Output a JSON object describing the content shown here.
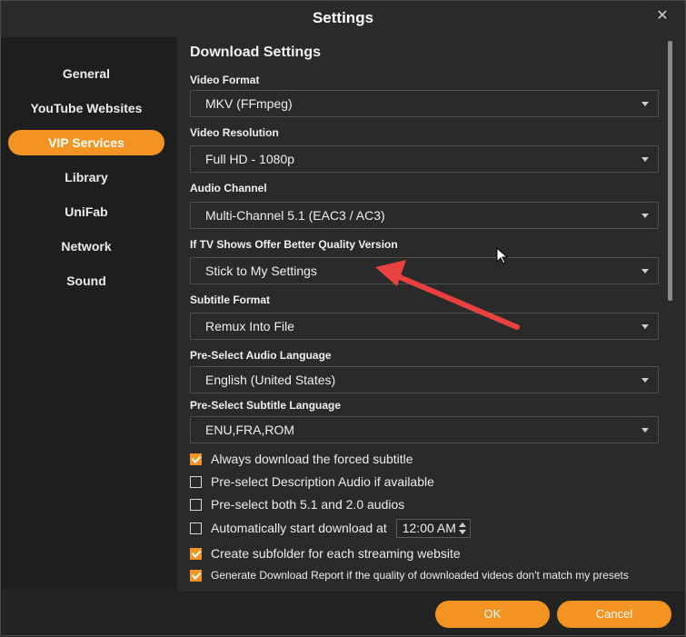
{
  "window": {
    "title": "Settings"
  },
  "sidebar": {
    "items": [
      {
        "label": "General"
      },
      {
        "label": "YouTube Websites"
      },
      {
        "label": "VIP Services"
      },
      {
        "label": "Library"
      },
      {
        "label": "UniFab"
      },
      {
        "label": "Network"
      },
      {
        "label": "Sound"
      }
    ],
    "active": "VIP Services"
  },
  "main": {
    "section_title": "Download Settings",
    "fields": [
      {
        "label": "Video Format",
        "value": "MKV (FFmpeg)"
      },
      {
        "label": "Video Resolution",
        "value": "Full HD - 1080p"
      },
      {
        "label": "Audio Channel",
        "value": "Multi-Channel 5.1 (EAC3 / AC3)"
      },
      {
        "label": "If TV Shows Offer Better Quality Version",
        "value": "Stick to My Settings"
      },
      {
        "label": "Subtitle Format",
        "value": "Remux Into File"
      },
      {
        "label": "Pre-Select Audio Language",
        "value": "English (United States)"
      },
      {
        "label": "Pre-Select Subtitle Language",
        "value": "ENU,FRA,ROM"
      }
    ],
    "checkboxes": [
      {
        "label": "Always download the forced subtitle",
        "checked": true
      },
      {
        "label": "Pre-select Description Audio if available",
        "checked": false
      },
      {
        "label": "Pre-select both 5.1 and 2.0 audios",
        "checked": false
      },
      {
        "label": "Automatically start download at",
        "checked": false,
        "time": "12:00 AM"
      },
      {
        "label": "Create subfolder for each streaming website",
        "checked": true
      },
      {
        "label": "Generate Download Report if the quality of downloaded videos don't match my presets",
        "checked": true
      }
    ]
  },
  "footer": {
    "ok_label": "OK",
    "cancel_label": "Cancel"
  },
  "colors": {
    "accent": "#f39322",
    "background": "#2a2a2a",
    "sidebar": "#1e1e1e",
    "annotation_arrow": "#e8413f"
  },
  "icons": {
    "close": "close-icon",
    "dropdown": "chevron-down-icon",
    "cursor": "mouse-pointer-icon",
    "arrow": "annotation-arrow-icon"
  }
}
